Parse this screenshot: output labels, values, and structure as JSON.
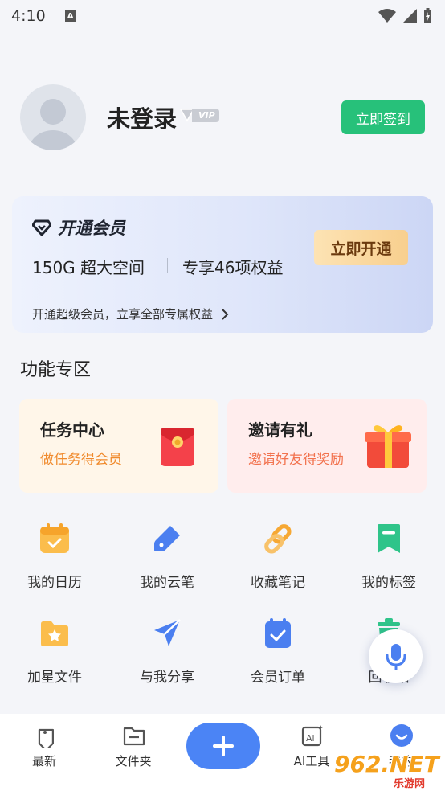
{
  "status_bar": {
    "time": "4:10",
    "notif_letter": "A"
  },
  "profile": {
    "name": "未登录",
    "vip_label": "VIP",
    "sign_in_button": "立即签到"
  },
  "vip_card": {
    "title": "开通会员",
    "feature_space": "150G 超大空间",
    "feature_benefits": "专享46项权益",
    "open_button": "立即开通",
    "bottom_text": "开通超级会员，立享全部专属权益"
  },
  "section_title": "功能专区",
  "promos": [
    {
      "title": "任务中心",
      "subtitle": "做任务得会员",
      "icon": "red-envelope-icon"
    },
    {
      "title": "邀请有礼",
      "subtitle": "邀请好友得奖励",
      "icon": "gift-box-icon"
    }
  ],
  "grid": [
    {
      "label": "我的日历",
      "icon": "calendar-icon"
    },
    {
      "label": "我的云笔",
      "icon": "pen-icon"
    },
    {
      "label": "收藏笔记",
      "icon": "link-icon"
    },
    {
      "label": "我的标签",
      "icon": "bookmark-icon"
    },
    {
      "label": "加星文件",
      "icon": "starred-folder-icon"
    },
    {
      "label": "与我分享",
      "icon": "send-icon"
    },
    {
      "label": "会员订单",
      "icon": "order-check-icon"
    },
    {
      "label": "回收站",
      "icon": "trash-icon"
    }
  ],
  "bottom_nav": [
    {
      "label": "最新",
      "icon": "tag-icon"
    },
    {
      "label": "文件夹",
      "icon": "folder-icon"
    },
    {
      "label": "",
      "icon": "plus-icon"
    },
    {
      "label": "AI工具",
      "icon": "ai-icon"
    },
    {
      "label": "我的",
      "icon": "profile-icon"
    }
  ],
  "watermark": {
    "main": "962.NET",
    "sub": "乐游网"
  },
  "colors": {
    "primary_blue": "#4b84f5",
    "sign_green": "#27c17a",
    "gold": "#f8cf8e",
    "orange_text": "#f08a2c"
  }
}
